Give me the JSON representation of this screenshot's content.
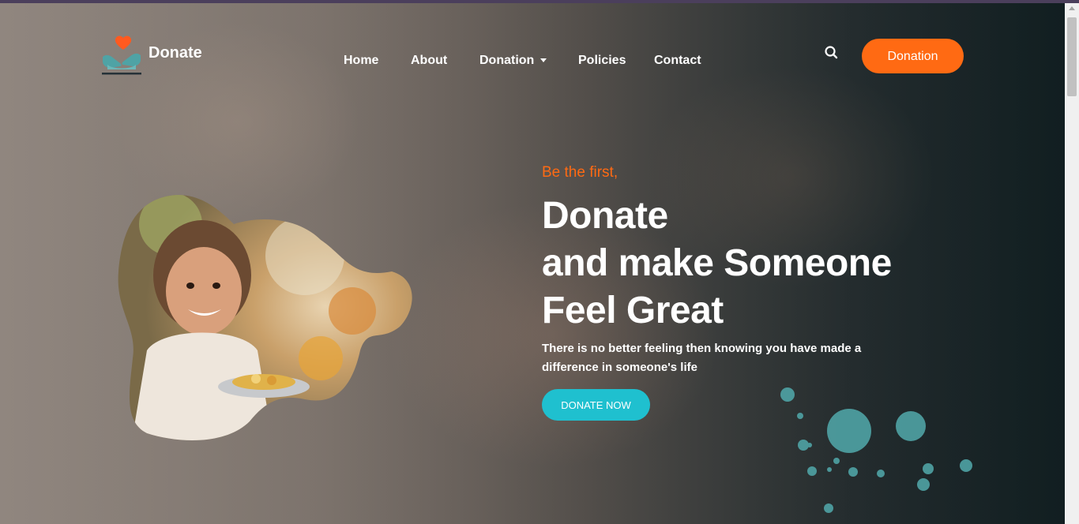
{
  "brand": {
    "name": "Donate",
    "icon": "heart-hands-icon"
  },
  "nav": {
    "items": [
      {
        "label": "Home"
      },
      {
        "label": "About"
      },
      {
        "label": "Donation",
        "has_dropdown": true
      },
      {
        "label": "Policies"
      },
      {
        "label": "Contact"
      }
    ]
  },
  "header": {
    "search_icon": "search-icon",
    "cta_label": "Donation"
  },
  "hero": {
    "kicker": "Be the first,",
    "headline": [
      "Donate",
      "and make Someone",
      "Feel Great"
    ],
    "subtext": "There is no better feeling then knowing you have made a difference in someone's life",
    "button_label": "DONATE NOW"
  },
  "colors": {
    "accent_orange": "#ff6a13",
    "accent_teal": "#1fc0cf",
    "splatter_teal": "#4fa3a5"
  }
}
